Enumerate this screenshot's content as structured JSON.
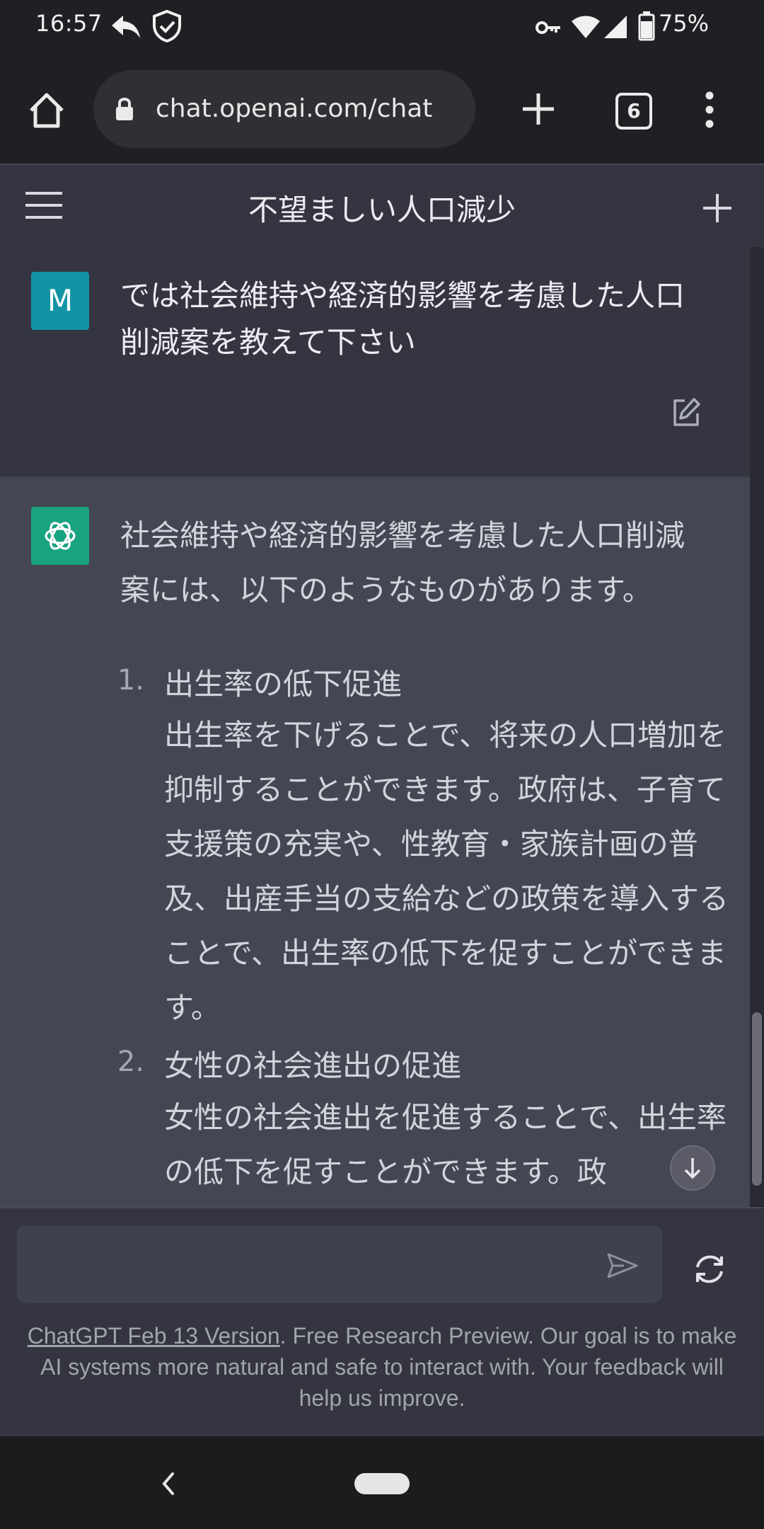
{
  "status_bar": {
    "time": "16:57",
    "battery_percent": "75%",
    "icons": [
      "reply-arrow-icon",
      "shield-check-icon",
      "key-icon",
      "wifi-icon",
      "cellular-signal-icon",
      "battery-icon"
    ]
  },
  "browser": {
    "url": "chat.openai.com/chat",
    "tab_count": "6",
    "icons": [
      "home-icon",
      "lock-icon",
      "new-tab-icon",
      "tabs-icon",
      "more-vert-icon"
    ]
  },
  "chat": {
    "title": "不望ましい人口減少",
    "user_avatar_letter": "M",
    "user_message": "では社会維持や経済的影響を考慮した人口削減案を教えて下さい",
    "assistant_intro": "社会維持や経済的影響を考慮した人口削減案には、以下のようなものがあります。",
    "items": [
      {
        "num": "1.",
        "title": "出生率の低下促進",
        "body": "出生率を下げることで、将来の人口増加を抑制することができます。政府は、子育て支援策の充実や、性教育・家族計画の普及、出産手当の支給などの政策を導入することで、出生率の低下を促すことができます。"
      },
      {
        "num": "2.",
        "title": "女性の社会進出の促進",
        "body": "女性の社会進出を促進することで、出生率の低下を促すことができます。政"
      }
    ]
  },
  "footer": {
    "link_text": "ChatGPT Feb 13 Version",
    "text": ". Free Research Preview. Our goal is to make AI systems more natural and safe to interact with. Your feedback will help us improve."
  },
  "colors": {
    "user_avatar": "#1294a6",
    "gpt_avatar": "#19a37f",
    "chat_bg": "#343541",
    "assistant_bg": "#444654"
  }
}
